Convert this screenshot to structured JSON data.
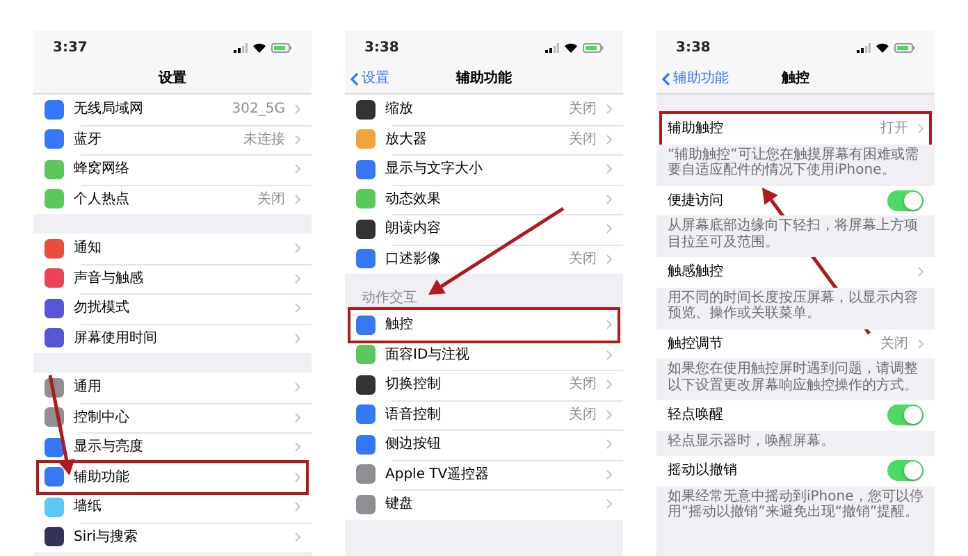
{
  "screens": [
    {
      "time": "3:37",
      "nav": {
        "title": "设置"
      },
      "groups": [
        {
          "rows": [
            {
              "label": "无线局域网",
              "value": "302_5G",
              "kind": "link",
              "color": "#3478f6"
            },
            {
              "label": "蓝牙",
              "value": "未连接",
              "kind": "link",
              "color": "#3478f6"
            },
            {
              "label": "蜂窝网络",
              "kind": "link",
              "color": "#5ac85a"
            },
            {
              "label": "个人热点",
              "value": "关闭",
              "kind": "link",
              "color": "#5ac85a"
            }
          ]
        },
        {
          "rows": [
            {
              "label": "通知",
              "kind": "link",
              "color": "#eb4d3d"
            },
            {
              "label": "声音与触感",
              "kind": "link",
              "color": "#eb445a"
            },
            {
              "label": "勿扰模式",
              "kind": "link",
              "color": "#5856d6"
            },
            {
              "label": "屏幕使用时间",
              "kind": "link",
              "color": "#5856d6"
            }
          ]
        },
        {
          "rows": [
            {
              "label": "通用",
              "kind": "link",
              "color": "#8e8e93"
            },
            {
              "label": "控制中心",
              "kind": "link",
              "color": "#8e8e93"
            },
            {
              "label": "显示与亮度",
              "kind": "link",
              "color": "#3478f6"
            },
            {
              "label": "辅助功能",
              "kind": "link",
              "color": "#3478f6",
              "highlighted": true
            },
            {
              "label": "墙纸",
              "kind": "link",
              "color": "#5ac8fa"
            },
            {
              "label": "Siri与搜索",
              "kind": "link",
              "color": "#333355"
            }
          ]
        }
      ]
    },
    {
      "time": "3:38",
      "nav": {
        "back": "设置",
        "title": "辅助功能"
      },
      "groups": [
        {
          "rows": [
            {
              "label": "缩放",
              "value": "关闭",
              "kind": "link",
              "color": "#333333"
            },
            {
              "label": "放大器",
              "value": "关闭",
              "kind": "link",
              "color": "#f2a33a"
            },
            {
              "label": "显示与文字大小",
              "kind": "link",
              "color": "#3478f6"
            },
            {
              "label": "动态效果",
              "kind": "link",
              "color": "#5ac85a"
            },
            {
              "label": "朗读内容",
              "kind": "link",
              "color": "#333333"
            },
            {
              "label": "口述影像",
              "value": "关闭",
              "kind": "link",
              "color": "#3478f6"
            }
          ]
        },
        {
          "header": "动作交互",
          "rows": [
            {
              "label": "触控",
              "kind": "link",
              "color": "#3478f6",
              "highlighted": true
            },
            {
              "label": "面容ID与注视",
              "kind": "link",
              "color": "#5ac85a"
            },
            {
              "label": "切换控制",
              "value": "关闭",
              "kind": "link",
              "color": "#333333"
            },
            {
              "label": "语音控制",
              "value": "关闭",
              "kind": "link",
              "color": "#3478f6"
            },
            {
              "label": "侧边按钮",
              "kind": "link",
              "color": "#3478f6"
            },
            {
              "label": "Apple TV遥控器",
              "kind": "link",
              "color": "#8e8e93"
            },
            {
              "label": "键盘",
              "kind": "link",
              "color": "#8e8e93"
            }
          ]
        }
      ]
    },
    {
      "time": "3:38",
      "nav": {
        "back": "辅助功能",
        "title": "触控"
      },
      "groups": [
        {
          "rows": [
            {
              "label": "辅助触控",
              "value": "打开",
              "kind": "link",
              "highlighted": true
            }
          ],
          "footer": "“辅助触控”可让您在触摸屏幕有困难或需要自适应配件的情况下使用iPhone。"
        },
        {
          "rows": [
            {
              "label": "便捷访问",
              "kind": "toggle",
              "on": true
            }
          ],
          "footer": "从屏幕底部边缘向下轻扫，将屏幕上方项目拉至可及范围。"
        },
        {
          "rows": [
            {
              "label": "触感触控",
              "kind": "link"
            }
          ],
          "footer": "用不同的时间长度按压屏幕，以显示内容预览、操作或关联菜单。"
        },
        {
          "rows": [
            {
              "label": "触控调节",
              "value": "关闭",
              "kind": "link"
            }
          ],
          "footer": "如果您在使用触控屏时遇到问题，请调整以下设置更改屏幕响应触控操作的方式。"
        },
        {
          "rows": [
            {
              "label": "轻点唤醒",
              "kind": "toggle",
              "on": true
            }
          ],
          "footer": "轻点显示器时，唤醒屏幕。"
        },
        {
          "rows": [
            {
              "label": "摇动以撤销",
              "kind": "toggle",
              "on": true
            }
          ],
          "footer": "如果经常无意中摇动到iPhone，您可以停用“摇动以撤销”来避免出现“撤销”提醒。"
        }
      ]
    }
  ]
}
